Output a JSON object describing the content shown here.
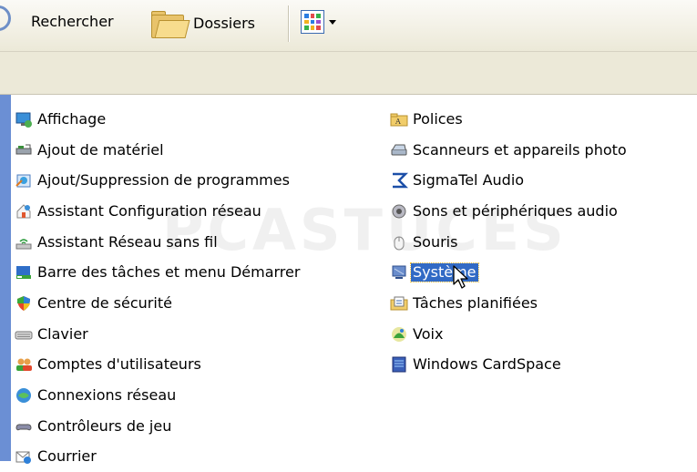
{
  "toolbar": {
    "search_label": "Rechercher",
    "folders_label": "Dossiers"
  },
  "watermark": "PCASTUCES",
  "left_items": [
    {
      "label": "Affichage",
      "icon": "display-icon"
    },
    {
      "label": "Ajout de matériel",
      "icon": "add-hardware-icon"
    },
    {
      "label": "Ajout/Suppression de programmes",
      "icon": "add-remove-programs-icon"
    },
    {
      "label": "Assistant Configuration réseau",
      "icon": "network-setup-icon"
    },
    {
      "label": "Assistant Réseau sans fil",
      "icon": "wireless-network-icon"
    },
    {
      "label": "Barre des tâches et menu Démarrer",
      "icon": "taskbar-icon"
    },
    {
      "label": "Centre de sécurité",
      "icon": "security-center-icon"
    },
    {
      "label": "Clavier",
      "icon": "keyboard-icon"
    },
    {
      "label": "Comptes d'utilisateurs",
      "icon": "user-accounts-icon"
    },
    {
      "label": "Connexions réseau",
      "icon": "network-connections-icon"
    },
    {
      "label": "Contrôleurs de jeu",
      "icon": "game-controller-icon"
    },
    {
      "label": "Courrier",
      "icon": "mail-icon"
    }
  ],
  "right_items": [
    {
      "label": "Polices",
      "icon": "fonts-folder-icon"
    },
    {
      "label": "Scanneurs et appareils photo",
      "icon": "scanner-camera-icon"
    },
    {
      "label": "SigmaTel Audio",
      "icon": "sigmatel-audio-icon"
    },
    {
      "label": "Sons et périphériques audio",
      "icon": "sound-speaker-icon"
    },
    {
      "label": "Souris",
      "icon": "mouse-icon"
    },
    {
      "label": "Système",
      "icon": "system-icon",
      "selected": true
    },
    {
      "label": "Tâches planifiées",
      "icon": "scheduled-tasks-icon"
    },
    {
      "label": "Voix",
      "icon": "speech-icon"
    },
    {
      "label": "Windows CardSpace",
      "icon": "cardspace-icon"
    }
  ],
  "colors": {
    "selection": "#316ac5",
    "toolbar_bg": "#ece9d8",
    "left_edge": "#6b8fd4"
  }
}
